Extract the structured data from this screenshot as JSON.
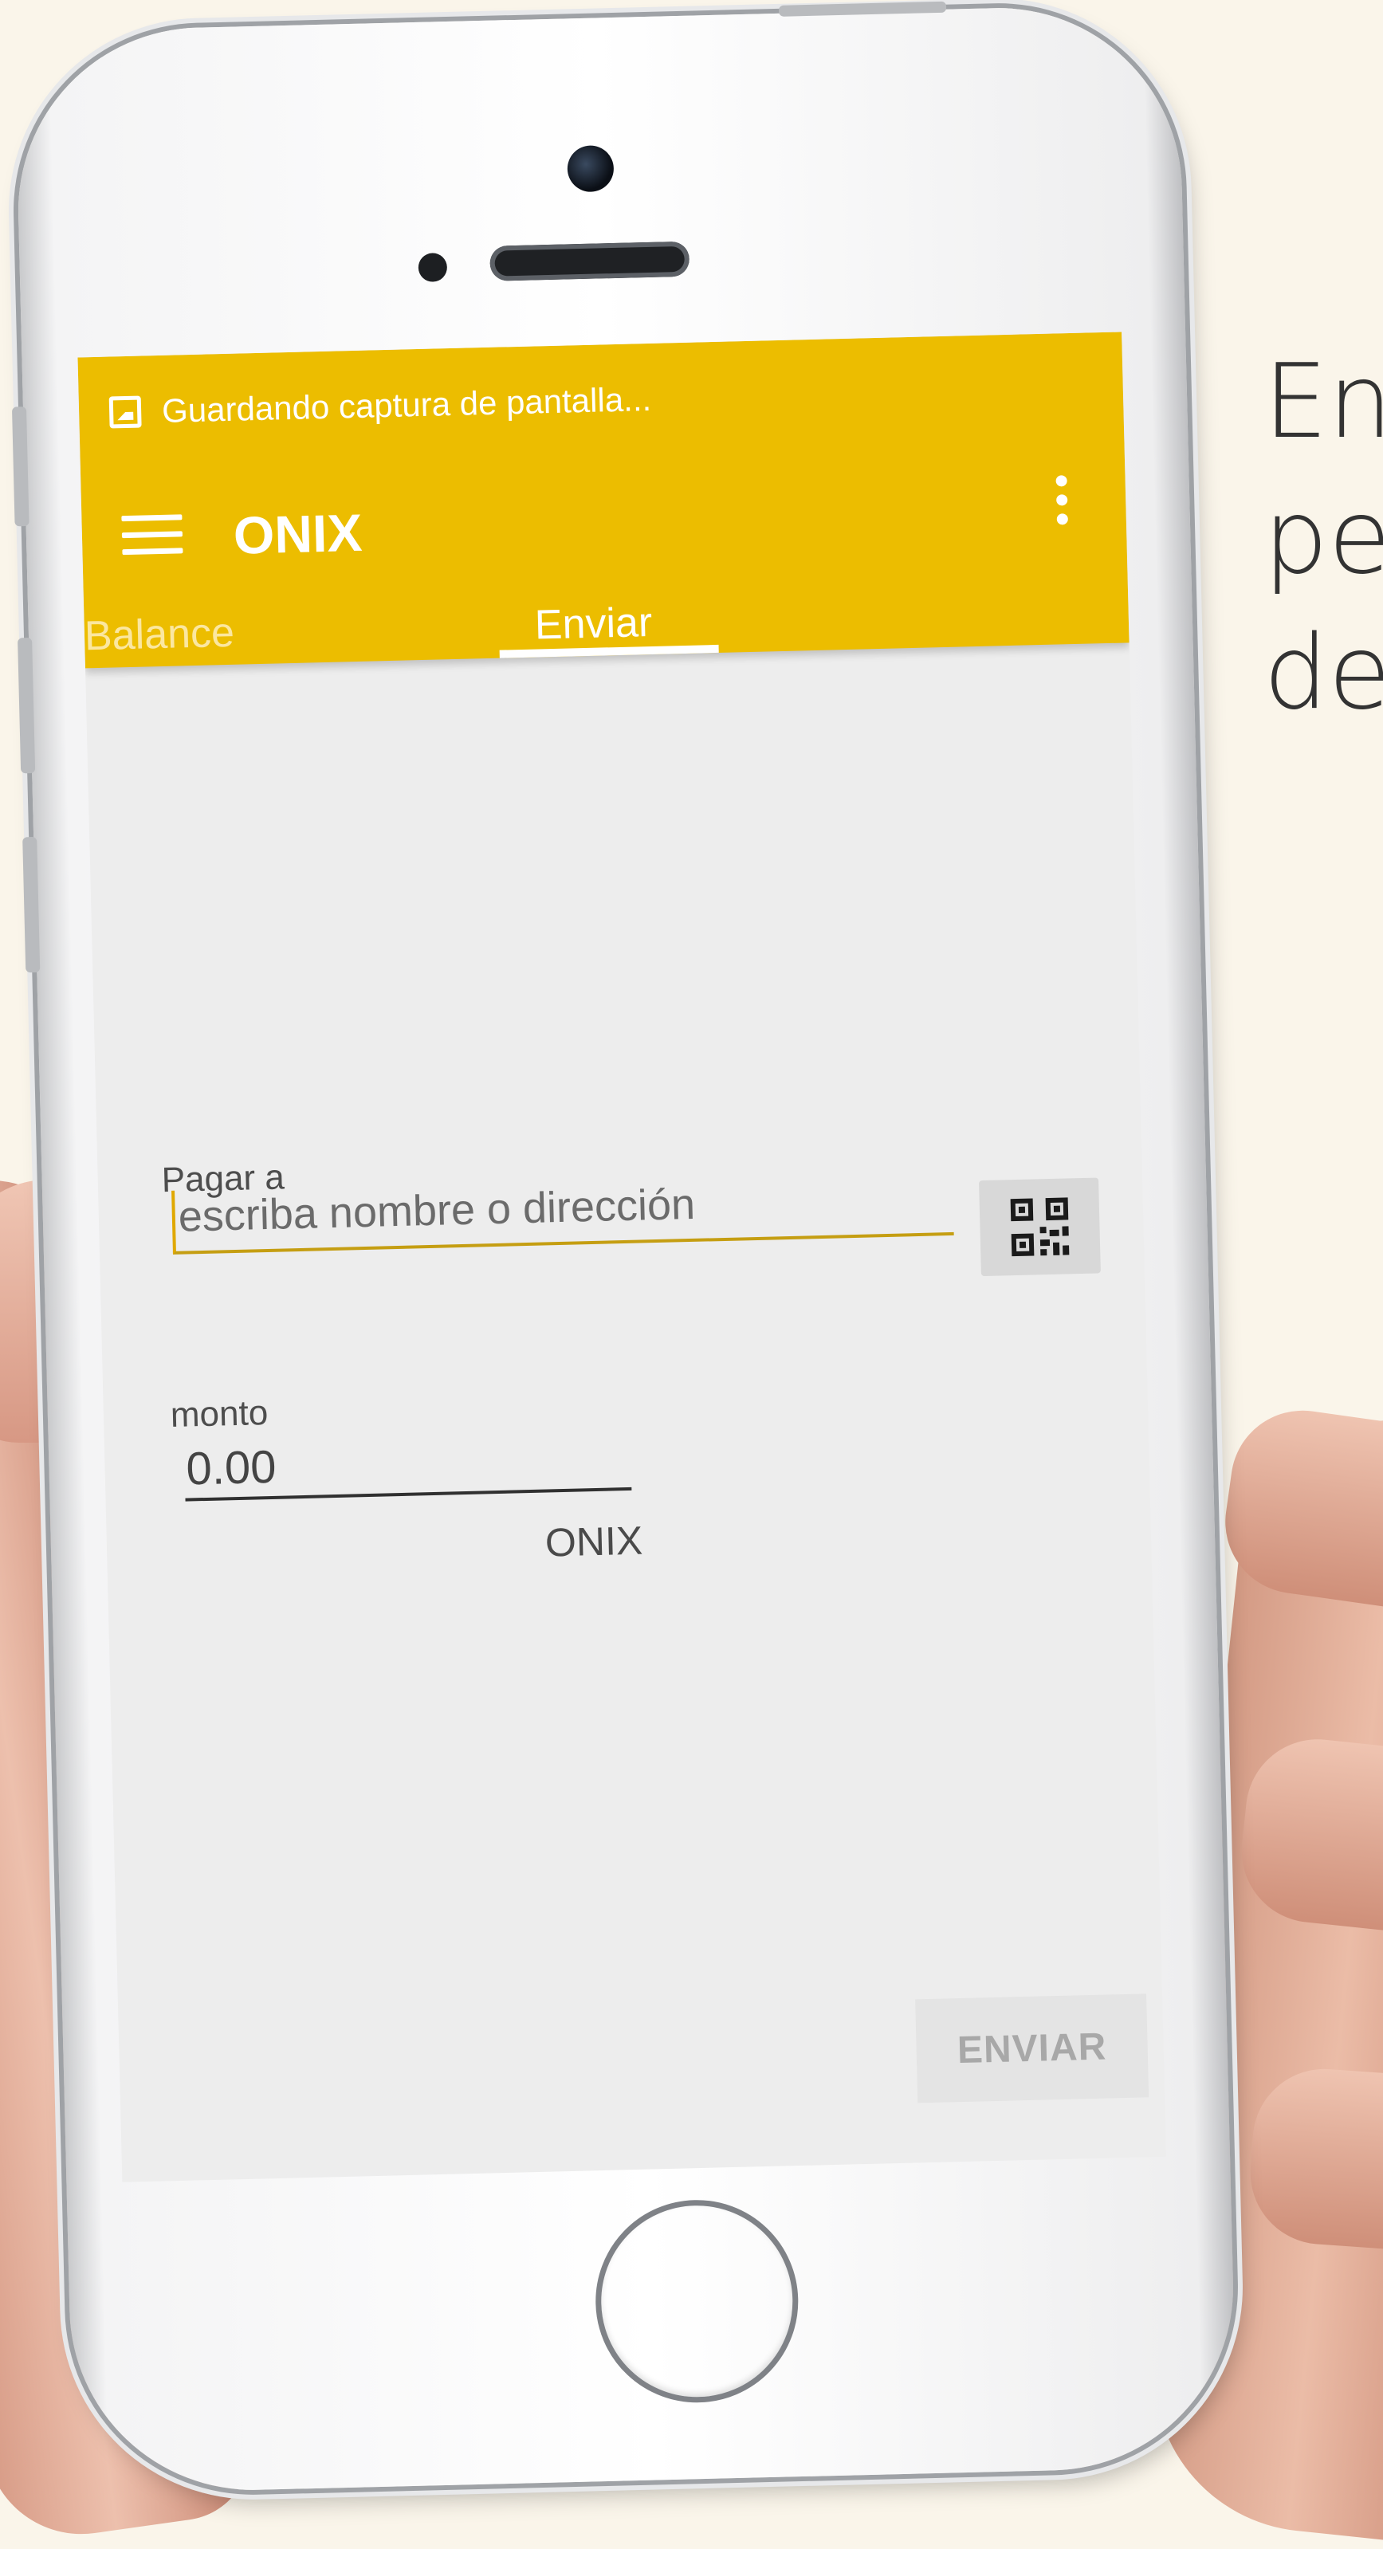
{
  "promo": {
    "lines": [
      "Env",
      "peq",
      "des"
    ]
  },
  "status_bar": {
    "notification": "Guardando captura de pantalla..."
  },
  "app_bar": {
    "title": "ONIX",
    "accent_color": "#ecbd00"
  },
  "tabs": [
    {
      "label": "Balance",
      "selected": false
    },
    {
      "label": "Enviar",
      "selected": true
    }
  ],
  "form": {
    "pay_to_label": "Pagar a",
    "pay_to_placeholder": "escriba nombre o dirección",
    "pay_to_value": "",
    "amount_label": "monto",
    "amount_value": "0.00",
    "unit": "ONIX",
    "send_button": "ENVIAR"
  },
  "icons": {
    "status": "image-icon",
    "menu": "hamburger-menu-icon",
    "overflow": "more-vertical-icon",
    "scan": "qr-code-icon"
  }
}
